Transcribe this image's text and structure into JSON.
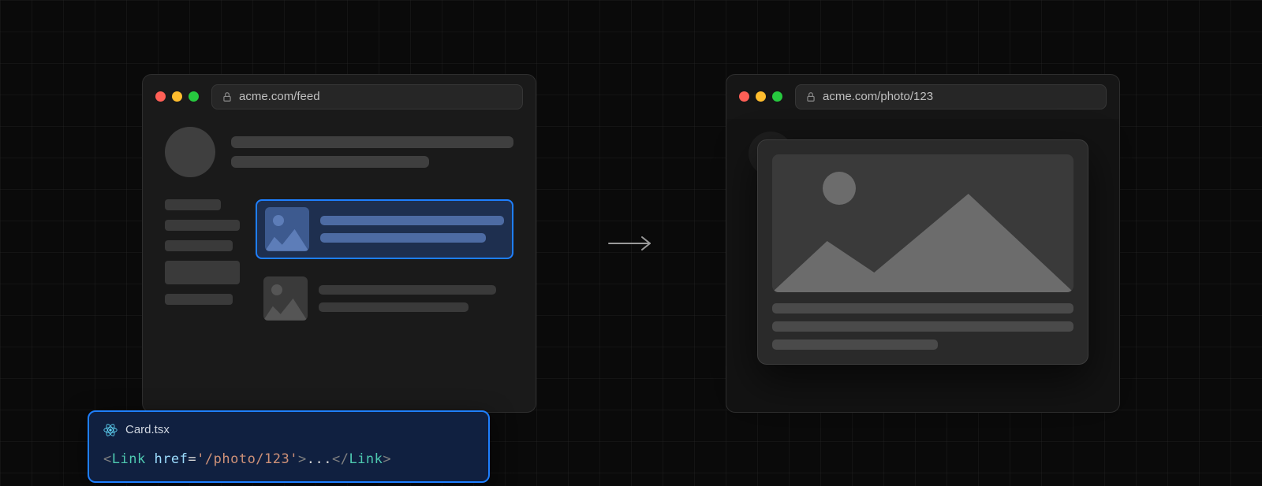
{
  "left_browser": {
    "url": "acme.com/feed"
  },
  "right_browser": {
    "url": "acme.com/photo/123"
  },
  "code_card": {
    "filename": "Card.tsx",
    "tag": "Link",
    "attr_name": "href",
    "attr_value": "'/photo/123'",
    "inner": "..."
  }
}
